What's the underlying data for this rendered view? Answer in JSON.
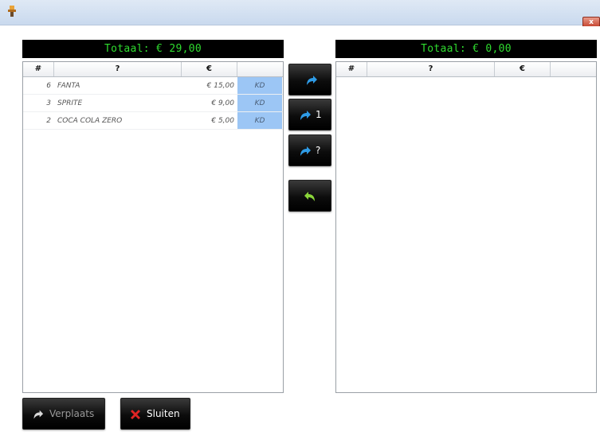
{
  "window": {
    "close_label": "x"
  },
  "left": {
    "total": "Totaal: € 29,00",
    "headers": [
      "#",
      "?",
      "€",
      ""
    ],
    "rows": [
      {
        "qty": "6",
        "name": "FANTA",
        "price": "€ 15,00",
        "tag": "KD"
      },
      {
        "qty": "3",
        "name": "SPRITE",
        "price": "€ 9,00",
        "tag": "KD"
      },
      {
        "qty": "2",
        "name": "COCA COLA ZERO",
        "price": "€ 5,00",
        "tag": "KD"
      }
    ]
  },
  "right": {
    "total": "Totaal: € 0,00",
    "headers": [
      "#",
      "?",
      "€",
      ""
    ]
  },
  "middle": {
    "move_one_suffix": "1",
    "move_custom_suffix": "?"
  },
  "bottom": {
    "move_label": "Verplaats",
    "close_label": "Sluiten"
  },
  "colors": {
    "total_text": "#2fdc2f",
    "tag_bg": "#9cc6f5",
    "arrow_blue": "#2e9be6",
    "arrow_green": "#8bd63a",
    "close_red": "#e02424"
  },
  "icons": [
    "app-icon",
    "redo-arrow-icon",
    "undo-arrow-icon",
    "close-x-icon"
  ]
}
